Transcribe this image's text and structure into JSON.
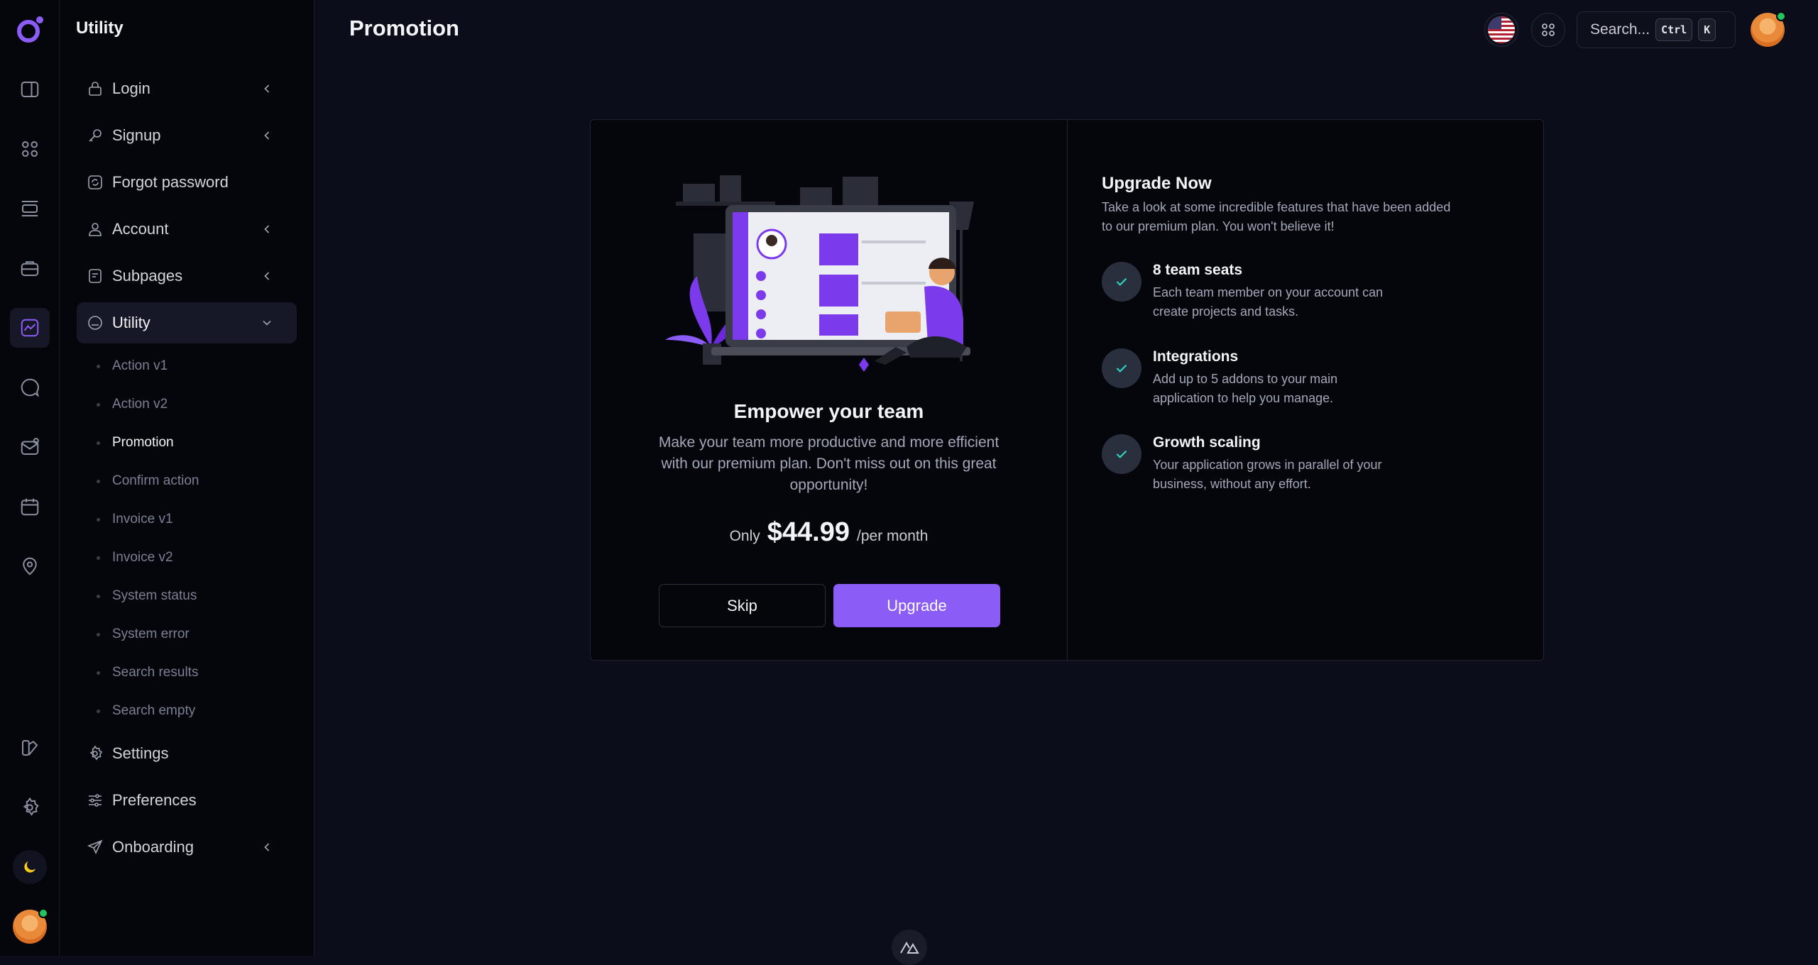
{
  "app": {
    "section_title": "Utility",
    "page_title": "Promotion"
  },
  "rail": {
    "icons": [
      "app-logo-icon",
      "layout-sidebar-icon",
      "grid-icon",
      "list-icon",
      "briefcase-icon",
      "chart-icon",
      "chat-icon",
      "mail-icon",
      "calendar-icon",
      "map-pin-icon",
      "brush-icon",
      "settings-icon",
      "moon-icon"
    ]
  },
  "sidebar": {
    "items": [
      {
        "label": "Login",
        "icon": "lock-icon",
        "has_chevron": true
      },
      {
        "label": "Signup",
        "icon": "key-icon",
        "has_chevron": true
      },
      {
        "label": "Forgot password",
        "icon": "refresh-icon",
        "has_chevron": false
      },
      {
        "label": "Account",
        "icon": "user-icon",
        "has_chevron": true
      },
      {
        "label": "Subpages",
        "icon": "document-icon",
        "has_chevron": true
      },
      {
        "label": "Utility",
        "icon": "box-icon",
        "has_chevron": true,
        "expanded": true
      }
    ],
    "subitems": [
      "Action v1",
      "Action v2",
      "Promotion",
      "Confirm action",
      "Invoice v1",
      "Invoice v2",
      "System status",
      "System error",
      "Search results",
      "Search empty"
    ],
    "active_subitem": "Promotion",
    "bottom_items": [
      {
        "label": "Settings",
        "icon": "gear-icon",
        "has_chevron": false
      },
      {
        "label": "Preferences",
        "icon": "sliders-icon",
        "has_chevron": false
      },
      {
        "label": "Onboarding",
        "icon": "send-icon",
        "has_chevron": true
      }
    ]
  },
  "topbar": {
    "search_placeholder": "Search...",
    "kbd_ctrl": "Ctrl",
    "kbd_k": "K"
  },
  "promo": {
    "title": "Empower your team",
    "body": "Make your team more productive and more efficient with our premium plan. Don't miss out on this great opportunity!",
    "price_prefix": "Only",
    "price": "$44.99",
    "price_suffix": "/per month",
    "skip_label": "Skip",
    "upgrade_label": "Upgrade"
  },
  "upgrade": {
    "title": "Upgrade Now",
    "subtitle": "Take a look at some incredible features that have been added to our premium plan. You won't believe it!",
    "features": [
      {
        "title": "8 team seats",
        "desc": "Each team member on your account can create projects and tasks."
      },
      {
        "title": "Integrations",
        "desc": "Add up to 5 addons to your main application to help you manage."
      },
      {
        "title": "Growth scaling",
        "desc": "Your application grows in parallel of your business, without any effort."
      }
    ]
  },
  "colors": {
    "accent": "#8b5cf6",
    "check": "#2dd4bf",
    "background": "#0b0e1a",
    "panel": "#05060b"
  }
}
